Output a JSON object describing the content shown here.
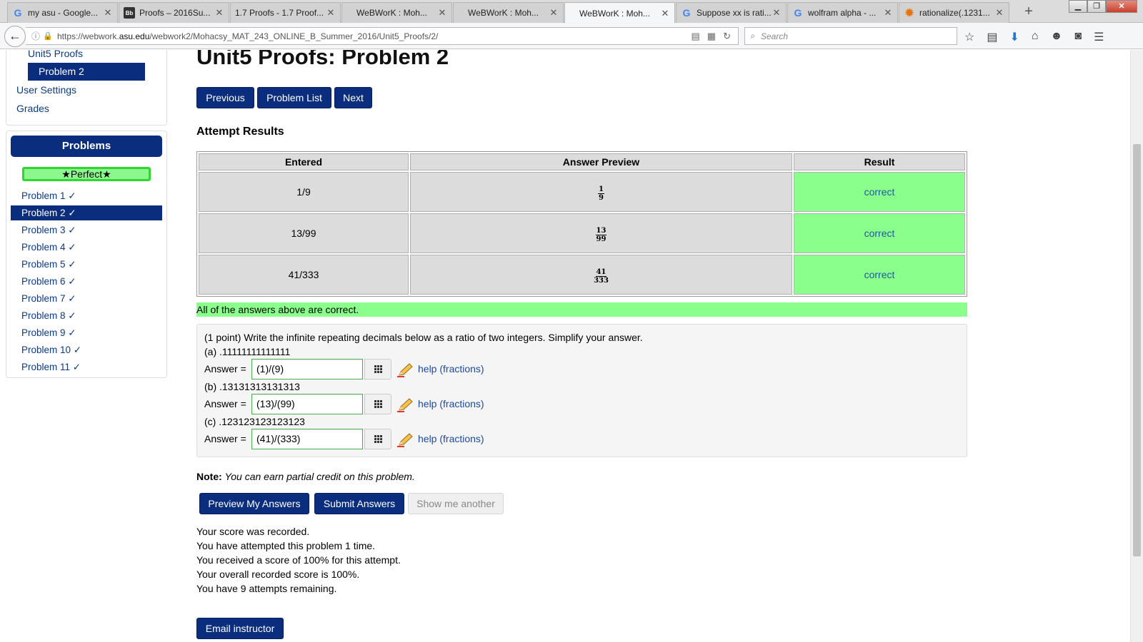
{
  "browser": {
    "tabs": [
      {
        "title": "my asu - Google...",
        "icon": "google-icon"
      },
      {
        "title": "Proofs – 2016Su...",
        "icon": "blackboard-icon"
      },
      {
        "title": "1.7 Proofs - 1.7 Proof...",
        "icon": "none"
      },
      {
        "title": "WeBWorK : Moh...",
        "icon": "none"
      },
      {
        "title": "WeBWorK : Moh...",
        "icon": "none"
      },
      {
        "title": "WeBWorK : Moh...",
        "icon": "none"
      },
      {
        "title": "Suppose xx is rati...",
        "icon": "google-icon"
      },
      {
        "title": "wolfram alpha - ...",
        "icon": "google-icon"
      },
      {
        "title": "rationalize(.1231...",
        "icon": "wolfram-icon"
      }
    ],
    "url_prefix": "https://webwork.",
    "url_domain": "asu.edu",
    "url_path": "/webwork2/Mohacsy_MAT_243_ONLINE_B_Summer_2016/Unit5_Proofs/2/",
    "search_placeholder": "Search"
  },
  "sidebar": {
    "unit_link": "Unit5 Proofs",
    "current_problem": "Problem 2",
    "user_settings": "User Settings",
    "grades": "Grades",
    "problems_header": "Problems",
    "perfect_badge": "★Perfect★",
    "problems": [
      "Problem 1 ✓",
      "Problem 2 ✓",
      "Problem 3 ✓",
      "Problem 4 ✓",
      "Problem 5 ✓",
      "Problem 6 ✓",
      "Problem 7 ✓",
      "Problem 8 ✓",
      "Problem 9 ✓",
      "Problem 10 ✓",
      "Problem 11 ✓"
    ]
  },
  "main": {
    "title": "Unit5 Proofs: Problem 2",
    "nav": {
      "previous": "Previous",
      "list": "Problem List",
      "next": "Next"
    },
    "attempt_heading": "Attempt Results",
    "results": {
      "headers": [
        "Entered",
        "Answer Preview",
        "Result"
      ],
      "rows": [
        {
          "entered": "1/9",
          "num": "1",
          "den": "9",
          "result": "correct"
        },
        {
          "entered": "13/99",
          "num": "13",
          "den": "99",
          "result": "correct"
        },
        {
          "entered": "41/333",
          "num": "41",
          "den": "333",
          "result": "correct"
        }
      ]
    },
    "all_correct": "All of the answers above are correct.",
    "problem": {
      "statement": "(1 point) Write the infinite repeating decimals below as a ratio of two integers. Simplify your answer.",
      "answer_label": "Answer =",
      "help_text": "help (fractions)",
      "parts": [
        {
          "label": "(a) .11111111111111",
          "value": "(1)/(9)"
        },
        {
          "label": "(b) .13131313131313",
          "value": "(13)/(99)"
        },
        {
          "label": "(c) .123123123123123",
          "value": "(41)/(333)"
        }
      ]
    },
    "note_label": "Note:",
    "note_text": "You can earn partial credit on this problem.",
    "actions": {
      "preview": "Preview My Answers",
      "submit": "Submit Answers",
      "another": "Show me another"
    },
    "status": [
      "Your score was recorded.",
      "You have attempted this problem 1 time.",
      "You received a score of 100% for this attempt.",
      "Your overall recorded score is 100%.",
      "You have 9 attempts remaining."
    ],
    "email_button": "Email instructor"
  },
  "colors": {
    "accent": "#0a2d7e",
    "correct": "#8bff8b",
    "link": "#0b3a82"
  }
}
